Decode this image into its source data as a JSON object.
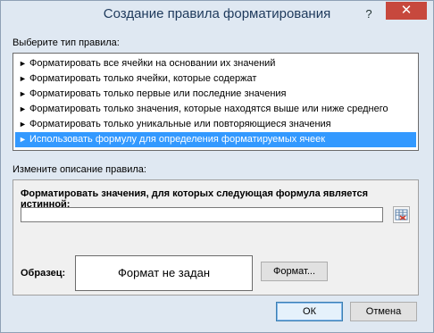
{
  "window": {
    "title": "Создание правила форматирования",
    "help_glyph": "?",
    "close_glyph": "✕"
  },
  "rule_type": {
    "label": "Выберите тип правила:",
    "items": [
      "Форматировать все ячейки на основании их значений",
      "Форматировать только ячейки, которые содержат",
      "Форматировать только первые или последние значения",
      "Форматировать только значения, которые находятся выше или ниже среднего",
      "Форматировать только уникальные или повторяющиеся значения",
      "Использовать формулу для определения форматируемых ячеек"
    ],
    "selected_index": 5,
    "item_glyph": "►"
  },
  "description": {
    "label": "Измените описание правила:",
    "formula_label": "Форматировать значения, для которых следующая формула является истинной:",
    "formula_value": "",
    "preview_label": "Образец:",
    "preview_text": "Формат не задан",
    "format_button": "Формат..."
  },
  "buttons": {
    "ok": "ОК",
    "cancel": "Отмена"
  },
  "colors": {
    "selection": "#3399ff",
    "close_button": "#c7483d"
  }
}
